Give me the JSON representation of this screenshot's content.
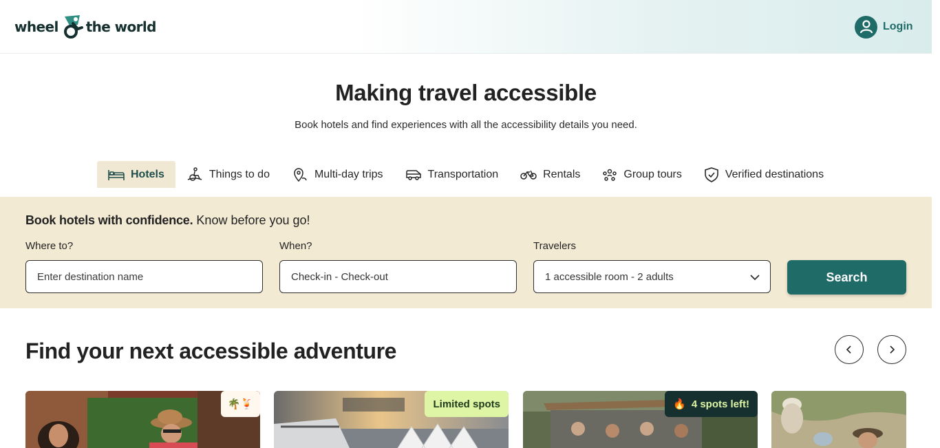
{
  "brand": {
    "name_left": "wheel",
    "name_right": "the world",
    "accent": "#1f6b68"
  },
  "header": {
    "login_label": "Login"
  },
  "hero": {
    "title": "Making travel accessible",
    "subtitle": "Book hotels and find experiences with all the accessibility details you need."
  },
  "tabs": [
    {
      "label": "Hotels",
      "icon": "bed-icon",
      "active": true
    },
    {
      "label": "Things to do",
      "icon": "wheelchair-person-icon"
    },
    {
      "label": "Multi-day trips",
      "icon": "map-pin-icon"
    },
    {
      "label": "Transportation",
      "icon": "van-icon"
    },
    {
      "label": "Rentals",
      "icon": "bicycle-icon"
    },
    {
      "label": "Group tours",
      "icon": "group-icon"
    },
    {
      "label": "Verified destinations",
      "icon": "shield-check-icon"
    }
  ],
  "search": {
    "headline_bold": "Book hotels with confidence.",
    "headline_rest": " Know before you go!",
    "where_label": "Where to?",
    "where_placeholder": "Enter destination name",
    "when_label": "When?",
    "when_value": "Check-in - Check-out",
    "travelers_label": "Travelers",
    "travelers_value": "1 accessible room - 2 adults",
    "button_label": "Search"
  },
  "adventures": {
    "title": "Find your next accessible adventure",
    "cards": [
      {
        "badge": "🌴🍹",
        "photo": "couple-toasting-outdoors"
      },
      {
        "badge": "Limited spots",
        "photo": "cruise-ship-harbor"
      },
      {
        "badge": "4 spots left!",
        "badge_icon": "🔥",
        "photo": "safari-vehicle-group"
      },
      {
        "photo": "hikers-outdoors"
      }
    ]
  },
  "colors": {
    "band": "#f3ead4",
    "tab_active": "#f1e8d3",
    "badge_green": "#dff5a6",
    "badge_dark": "#15302e"
  }
}
